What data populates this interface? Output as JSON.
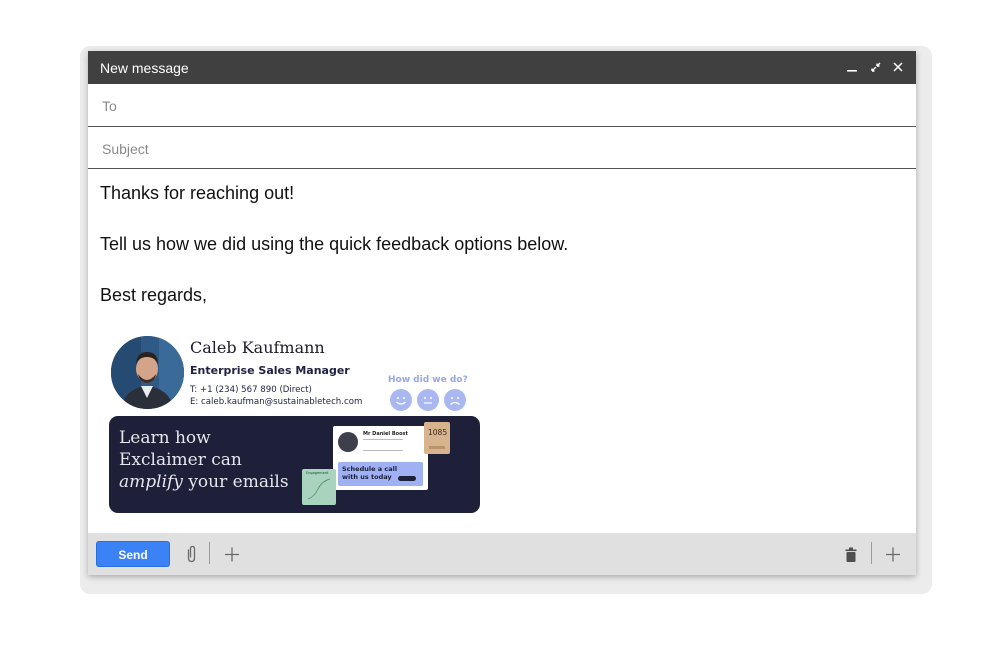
{
  "window": {
    "title": "New message",
    "controls": {
      "minimize": "_",
      "expand": "⤡",
      "close": "×"
    }
  },
  "fields": {
    "to": {
      "placeholder": "To",
      "value": ""
    },
    "subject": {
      "placeholder": "Subject",
      "value": ""
    }
  },
  "body": {
    "lines": [
      "Thanks for reaching out!",
      "Tell us how we did using the quick feedback options below.",
      "Best regards,"
    ]
  },
  "signature": {
    "name": "Caleb Kaufmann",
    "role": "Enterprise Sales Manager",
    "phone": "T: +1 (234) 567 890 (Direct)",
    "email": "E: caleb.kaufman@sustainabletech.com",
    "feedback": {
      "label": "How did we do?",
      "faces": [
        "happy",
        "neutral",
        "sad"
      ],
      "face_color": "#a9b8f0"
    },
    "banner": {
      "line1": "Learn how",
      "line2": "Exclaimer can",
      "line3_em": "amplify",
      "line3_rest": " your emails",
      "card_name": "Mr Daniel Boost",
      "card_cta": "Schedule a call with us today",
      "card_cta_line1": "Schedule a call",
      "card_cta_line2": "with us today",
      "badge": "1085",
      "chart_label": "Engagement",
      "background": "#1d2038"
    }
  },
  "toolbar": {
    "send_label": "Send",
    "accent": "#3b82f6",
    "icons": [
      "paperclip-icon",
      "plus-icon",
      "trash-icon",
      "plus-icon"
    ]
  }
}
